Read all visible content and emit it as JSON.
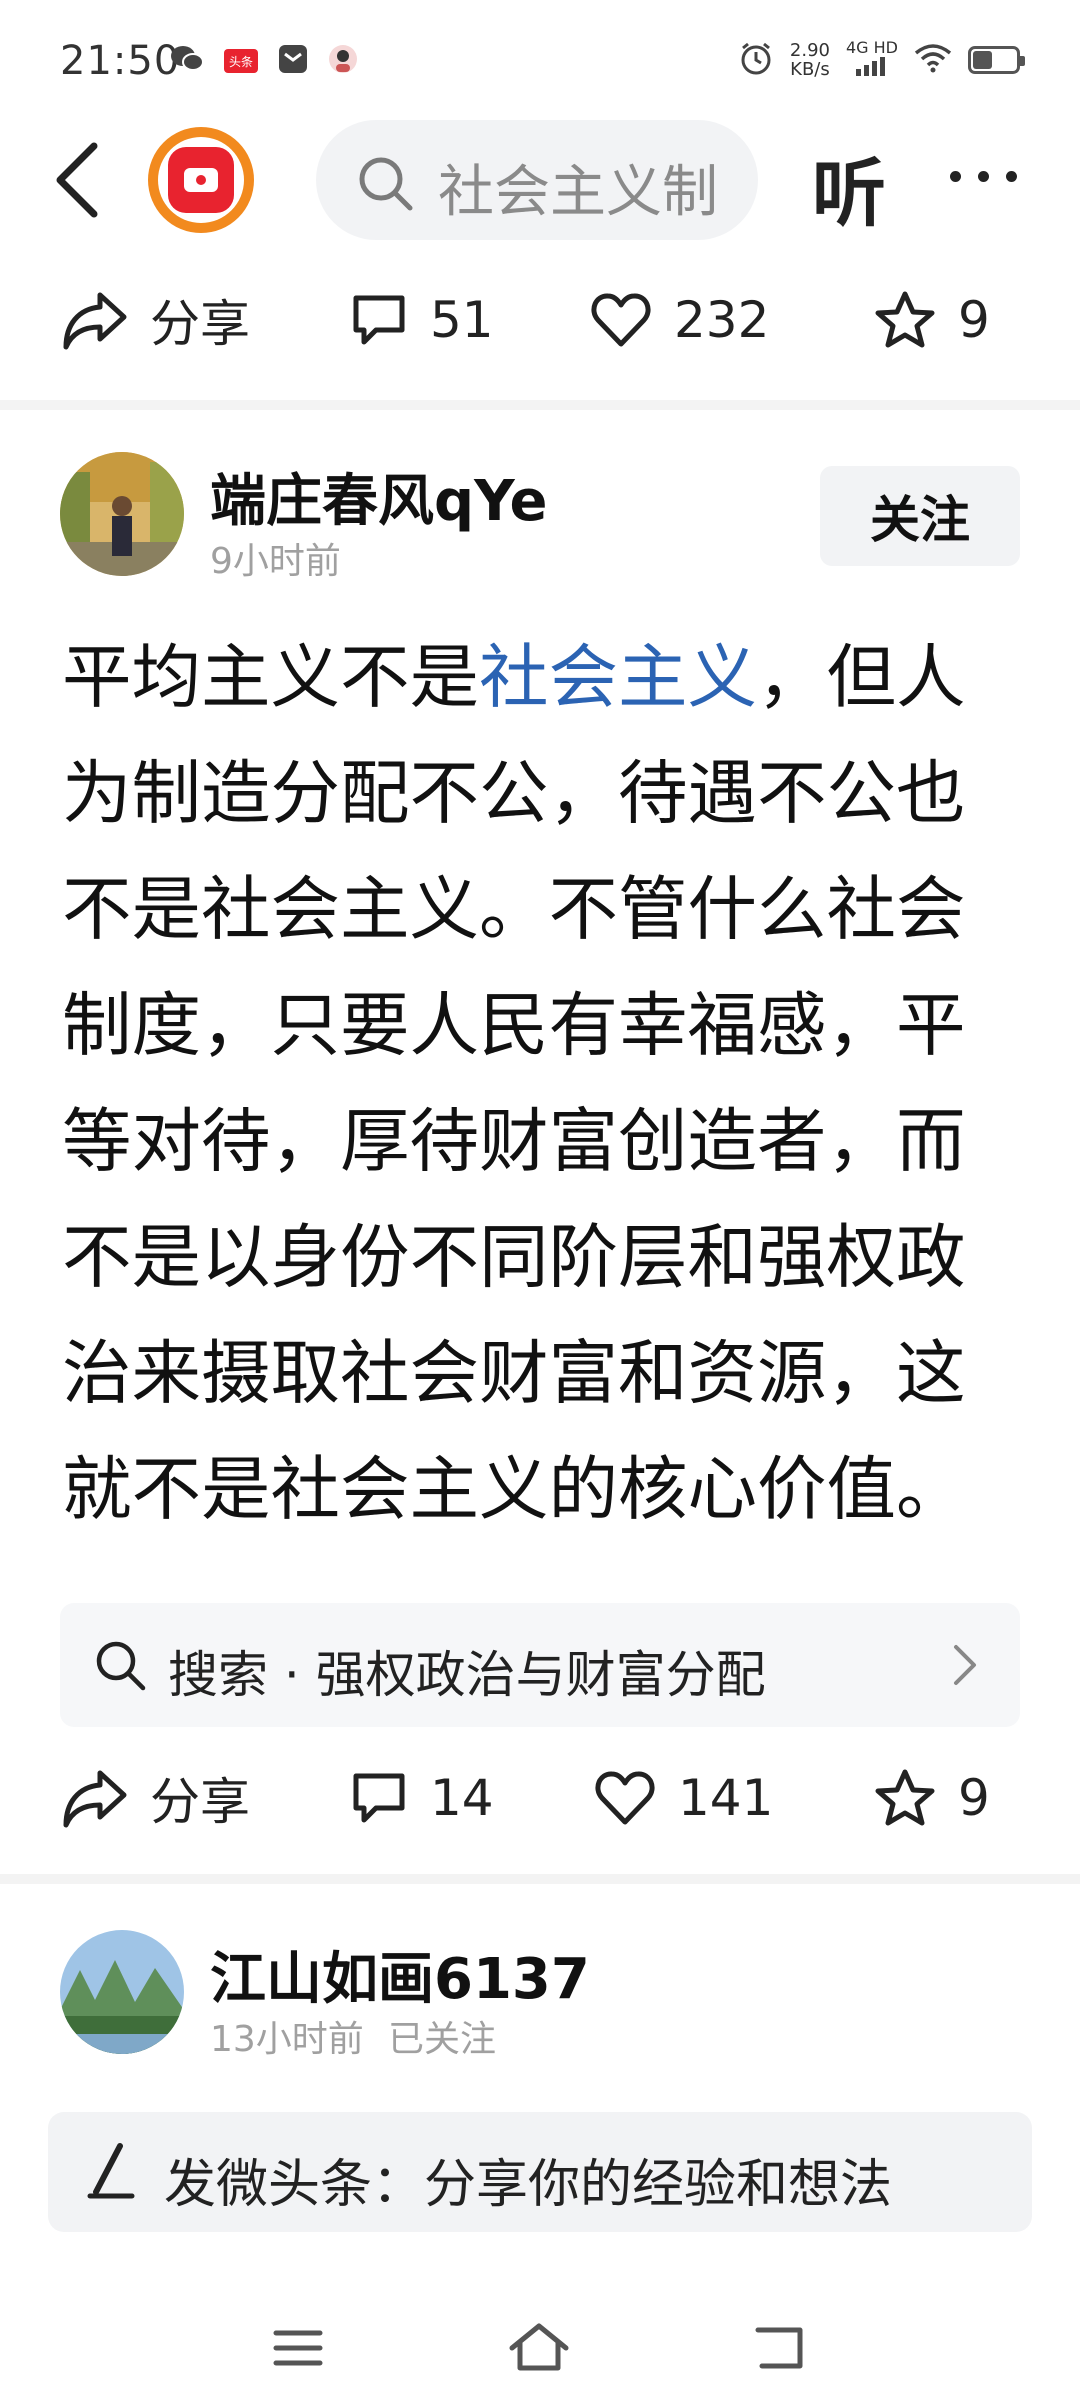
{
  "status_bar": {
    "time": "21:50",
    "net_speed_value": "2.90",
    "net_speed_unit": "KB/s",
    "network_type": "4G HD",
    "battery_level": 0.45,
    "left_icons": [
      "wechat-icon",
      "toutiao-icon",
      "message-icon",
      "avatar-icon"
    ],
    "toutiao_label": "头条"
  },
  "nav": {
    "search_placeholder": "社会主义制",
    "listen_label": "听"
  },
  "post_actions_top": {
    "share_label": "分享",
    "comment_count": "51",
    "like_count": "232",
    "favorite_count": "9"
  },
  "post": {
    "author": "端庄春风qYe",
    "time": "9小时前",
    "follow_label": "关注",
    "text_before": "平均主义不是",
    "text_keyword": "社会主义",
    "text_after": "，但人为制造分配不公，待遇不公也不是社会主义。不管什么社会制度，只要人民有幸福感，平等对待，厚待财富创造者，而不是以身份不同阶层和强权政治来摄取社会财富和资源，这就不是社会主义的核心价值。",
    "search_suggestion": "搜索 · 强权政治与财富分配",
    "share_label": "分享",
    "comment_count": "14",
    "like_count": "141",
    "favorite_count": "9"
  },
  "next_post": {
    "author": "江山如画6137",
    "time": "13小时前",
    "follow_status": "已关注"
  },
  "composer": {
    "placeholder": "发微头条：分享你的经验和想法"
  },
  "colors": {
    "keyword_link": "#2b63b3",
    "app_logo_ring": "#f28a1e",
    "app_logo_red": "#e8232f"
  }
}
